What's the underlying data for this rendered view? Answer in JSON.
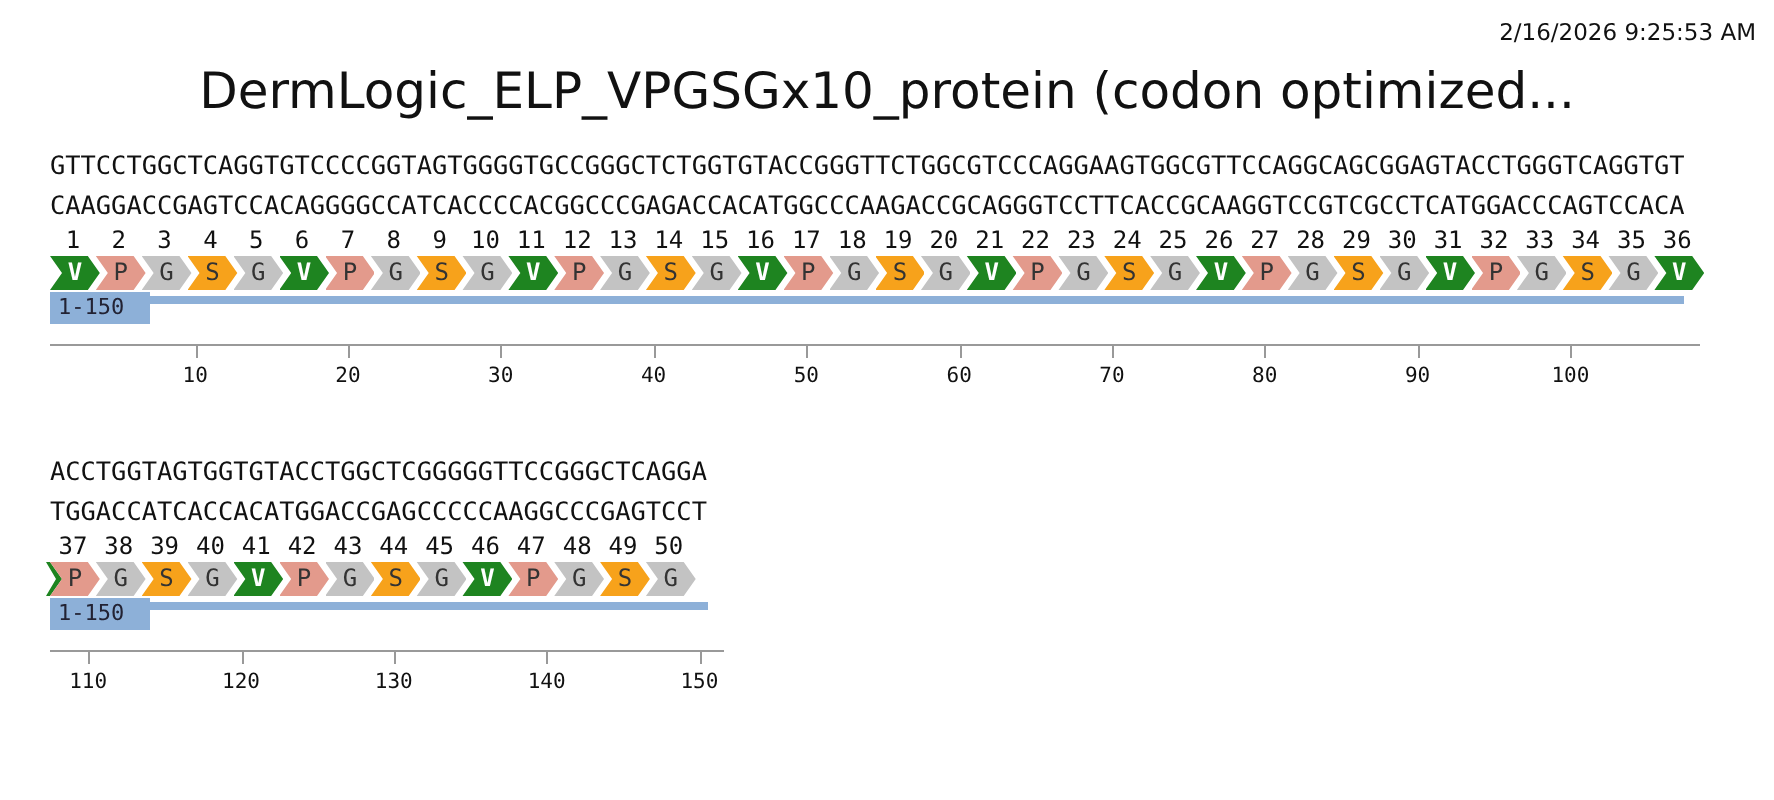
{
  "timestamp": "2/16/2026 9:25:53 AM",
  "title": "DermLogic_ELP_VPGSGx10_protein (codon optimized...",
  "rows": [
    {
      "top_strand": "GTTCCTGGCTCAGGTGTCCCCGGTAGTGGGGTGCCGGGCTCTGGTGTACCGGGTTCTGGCGTCCCAGGAAGTGGCGTTCCAGGCAGCGGAGTACCTGGGTCAGGTGT",
      "bottom_strand": "CAAGGACCGAGTCCACAGGGGCCATCACCCCACGGCCCGAGACCACATGGCCCAAGACCGCAGGGTCCTTCACCGCAAGGTCCGTCGCCTCATGGACCCAGTCCACA",
      "residues": [
        {
          "number": "1",
          "letter": "V",
          "color": "#1e8420"
        },
        {
          "number": "2",
          "letter": "P",
          "color": "#e39a8c"
        },
        {
          "number": "3",
          "letter": "G",
          "color": "#c3c3c3"
        },
        {
          "number": "4",
          "letter": "S",
          "color": "#f7a21b"
        },
        {
          "number": "5",
          "letter": "G",
          "color": "#c3c3c3"
        },
        {
          "number": "6",
          "letter": "V",
          "color": "#1e8420"
        },
        {
          "number": "7",
          "letter": "P",
          "color": "#e39a8c"
        },
        {
          "number": "8",
          "letter": "G",
          "color": "#c3c3c3"
        },
        {
          "number": "9",
          "letter": "S",
          "color": "#f7a21b"
        },
        {
          "number": "10",
          "letter": "G",
          "color": "#c3c3c3"
        },
        {
          "number": "11",
          "letter": "V",
          "color": "#1e8420"
        },
        {
          "number": "12",
          "letter": "P",
          "color": "#e39a8c"
        },
        {
          "number": "13",
          "letter": "G",
          "color": "#c3c3c3"
        },
        {
          "number": "14",
          "letter": "S",
          "color": "#f7a21b"
        },
        {
          "number": "15",
          "letter": "G",
          "color": "#c3c3c3"
        },
        {
          "number": "16",
          "letter": "V",
          "color": "#1e8420"
        },
        {
          "number": "17",
          "letter": "P",
          "color": "#e39a8c"
        },
        {
          "number": "18",
          "letter": "G",
          "color": "#c3c3c3"
        },
        {
          "number": "19",
          "letter": "S",
          "color": "#f7a21b"
        },
        {
          "number": "20",
          "letter": "G",
          "color": "#c3c3c3"
        },
        {
          "number": "21",
          "letter": "V",
          "color": "#1e8420"
        },
        {
          "number": "22",
          "letter": "P",
          "color": "#e39a8c"
        },
        {
          "number": "23",
          "letter": "G",
          "color": "#c3c3c3"
        },
        {
          "number": "24",
          "letter": "S",
          "color": "#f7a21b"
        },
        {
          "number": "25",
          "letter": "G",
          "color": "#c3c3c3"
        },
        {
          "number": "26",
          "letter": "V",
          "color": "#1e8420"
        },
        {
          "number": "27",
          "letter": "P",
          "color": "#e39a8c"
        },
        {
          "number": "28",
          "letter": "G",
          "color": "#c3c3c3"
        },
        {
          "number": "29",
          "letter": "S",
          "color": "#f7a21b"
        },
        {
          "number": "30",
          "letter": "G",
          "color": "#c3c3c3"
        },
        {
          "number": "31",
          "letter": "V",
          "color": "#1e8420"
        },
        {
          "number": "32",
          "letter": "P",
          "color": "#e39a8c"
        },
        {
          "number": "33",
          "letter": "G",
          "color": "#c3c3c3"
        },
        {
          "number": "34",
          "letter": "S",
          "color": "#f7a21b"
        },
        {
          "number": "35",
          "letter": "G",
          "color": "#c3c3c3"
        },
        {
          "number": "36",
          "letter": "V",
          "color": "#1e8420"
        }
      ],
      "feature": {
        "label": "1-150"
      },
      "ruler": [
        "10",
        "20",
        "30",
        "40",
        "50",
        "60",
        "70",
        "80",
        "90",
        "100"
      ]
    },
    {
      "top_strand": "ACCTGGTAGTGGTGTACCTGGCTCGGGGGTTCCGGGCTCAGGA",
      "bottom_strand": "TGGACCATCACCACATGGACCGAGCCCCCAAGGCCCGAGTCCT",
      "residues": [
        {
          "number": "37",
          "letter": "P",
          "color": "#e39a8c"
        },
        {
          "number": "38",
          "letter": "G",
          "color": "#c3c3c3"
        },
        {
          "number": "39",
          "letter": "S",
          "color": "#f7a21b"
        },
        {
          "number": "40",
          "letter": "G",
          "color": "#c3c3c3"
        },
        {
          "number": "41",
          "letter": "V",
          "color": "#1e8420"
        },
        {
          "number": "42",
          "letter": "P",
          "color": "#e39a8c"
        },
        {
          "number": "43",
          "letter": "G",
          "color": "#c3c3c3"
        },
        {
          "number": "44",
          "letter": "S",
          "color": "#f7a21b"
        },
        {
          "number": "45",
          "letter": "G",
          "color": "#c3c3c3"
        },
        {
          "number": "46",
          "letter": "V",
          "color": "#1e8420"
        },
        {
          "number": "47",
          "letter": "P",
          "color": "#e39a8c"
        },
        {
          "number": "48",
          "letter": "G",
          "color": "#c3c3c3"
        },
        {
          "number": "49",
          "letter": "S",
          "color": "#f7a21b"
        },
        {
          "number": "50",
          "letter": "G",
          "color": "#c3c3c3"
        }
      ],
      "feature": {
        "label": "1-150"
      },
      "ruler": [
        "110",
        "120",
        "130",
        "140",
        "150"
      ]
    }
  ]
}
